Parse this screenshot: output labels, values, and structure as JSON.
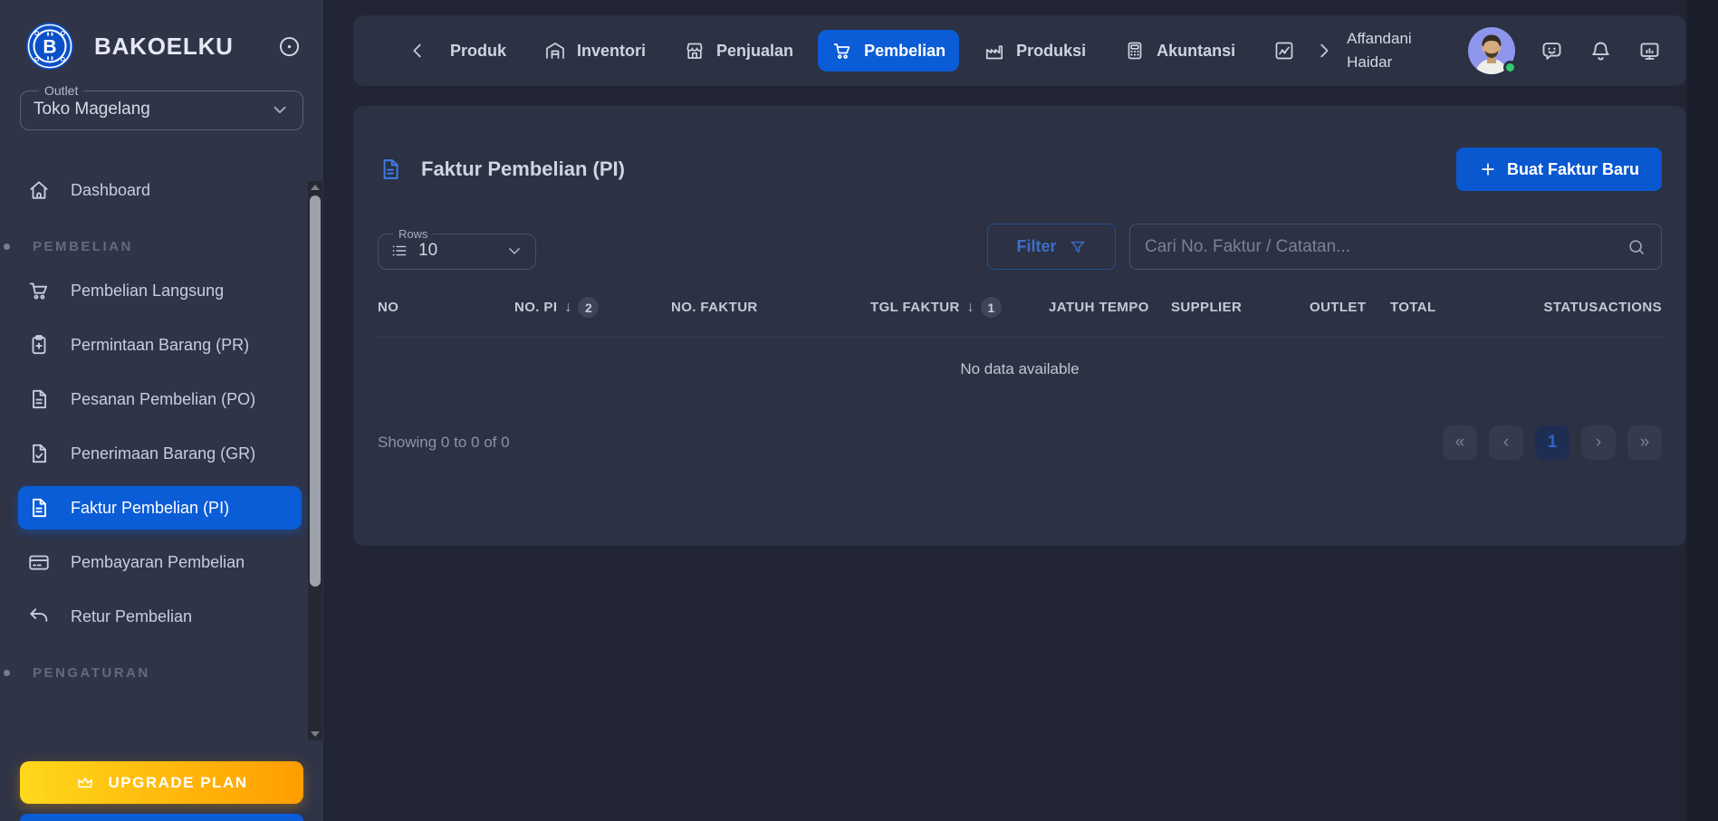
{
  "brand": {
    "name": "BAKOELKU"
  },
  "sidebar": {
    "outlet": {
      "label": "Outlet",
      "value": "Toko Magelang"
    },
    "dashboard": {
      "label": "Dashboard",
      "icon": "home"
    },
    "sections": [
      {
        "label": "PEMBELIAN",
        "items": [
          {
            "label": "Pembelian Langsung",
            "icon": "cart"
          },
          {
            "label": "Permintaan Barang (PR)",
            "icon": "clipboard-plus"
          },
          {
            "label": "Pesanan Pembelian (PO)",
            "icon": "doc-lines"
          },
          {
            "label": "Penerimaan Barang (GR)",
            "icon": "doc-check"
          },
          {
            "label": "Faktur Pembelian (PI)",
            "icon": "invoice",
            "active": true
          },
          {
            "label": "Pembayaran Pembelian",
            "icon": "credit-card"
          },
          {
            "label": "Retur Pembelian",
            "icon": "return-arrow"
          }
        ]
      },
      {
        "label": "PENGATURAN",
        "items": []
      }
    ],
    "upgrade": {
      "label": "UPGRADE PLAN"
    }
  },
  "topnav": {
    "items": [
      {
        "label": "Produk"
      },
      {
        "label": "Inventori",
        "icon": "warehouse"
      },
      {
        "label": "Penjualan",
        "icon": "store"
      },
      {
        "label": "Pembelian",
        "icon": "cart",
        "active": true
      },
      {
        "label": "Produksi",
        "icon": "factory"
      },
      {
        "label": "Akuntansi",
        "icon": "calculator"
      },
      {
        "label": "",
        "icon": "chart"
      }
    ],
    "user": {
      "name": "Affandani Haidar"
    }
  },
  "page": {
    "title": "Faktur Pembelian (PI)",
    "create_button": "Buat Faktur Baru",
    "controls": {
      "rows_label": "Rows",
      "rows_value": "10",
      "filter_label": "Filter",
      "search_placeholder": "Cari No. Faktur / Catatan..."
    },
    "table": {
      "columns": [
        {
          "label": "NO"
        },
        {
          "label": "NO. PI",
          "sorted": true,
          "sort_dir": "desc",
          "sort_order": "2"
        },
        {
          "label": "NO. FAKTUR"
        },
        {
          "label": "TGL FAKTUR",
          "sorted": true,
          "sort_dir": "desc",
          "sort_order": "1"
        },
        {
          "label": "JATUH TEMPO"
        },
        {
          "label": "SUPPLIER"
        },
        {
          "label": "OUTLET"
        },
        {
          "label": "TOTAL"
        },
        {
          "label": "STATUS"
        },
        {
          "label": "ACTIONS"
        }
      ],
      "rows": [],
      "empty_text": "No data available",
      "summary": "Showing 0 to 0 of 0"
    },
    "pagination": {
      "buttons": [
        {
          "glyph": "«",
          "type": "first"
        },
        {
          "glyph": "‹",
          "type": "prev"
        },
        {
          "glyph": "1",
          "type": "page",
          "active": true
        },
        {
          "glyph": "›",
          "type": "next"
        },
        {
          "glyph": "»",
          "type": "last"
        }
      ]
    }
  },
  "colors": {
    "accent": "#0B5CD7",
    "accent-deep": "#0A58CF",
    "upgrade-start": "#FFD81B",
    "upgrade-end": "#FF9D00",
    "online": "#2FCB6F",
    "card-bg": "#2C3143"
  }
}
